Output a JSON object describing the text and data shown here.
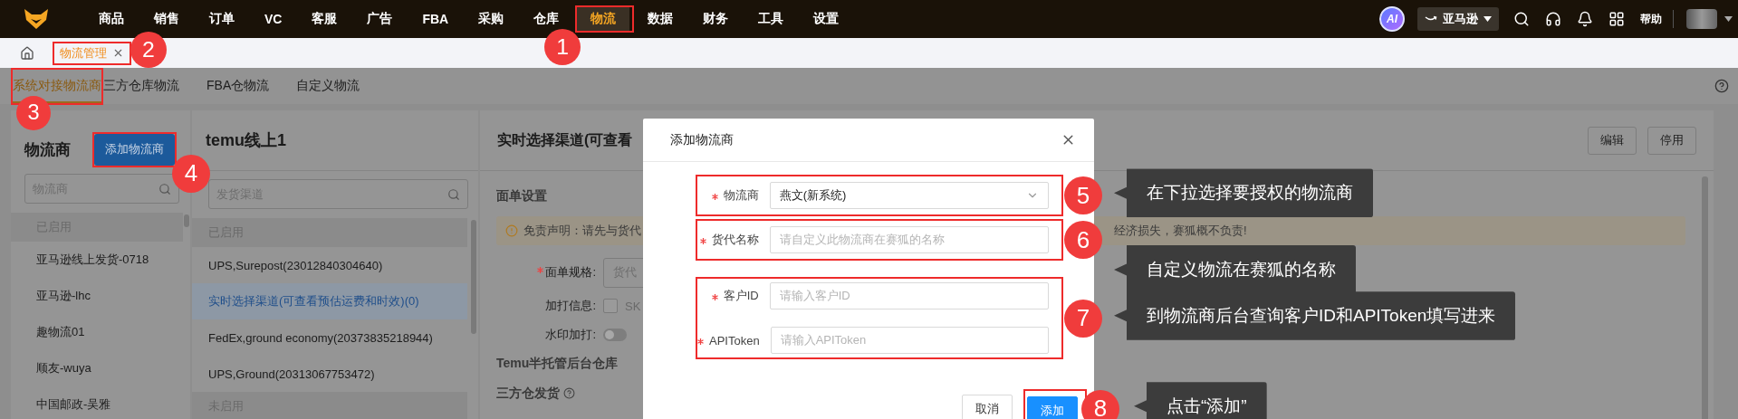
{
  "top_nav": {
    "items": [
      {
        "label": "商品",
        "selected": false
      },
      {
        "label": "销售",
        "selected": false
      },
      {
        "label": "订单",
        "selected": false
      },
      {
        "label": "VC",
        "selected": false
      },
      {
        "label": "客服",
        "selected": false
      },
      {
        "label": "广告",
        "selected": false
      },
      {
        "label": "FBA",
        "selected": false
      },
      {
        "label": "采购",
        "selected": false
      },
      {
        "label": "仓库",
        "selected": false
      },
      {
        "label": "物流",
        "selected": true,
        "step": "1"
      },
      {
        "label": "数据",
        "selected": false
      },
      {
        "label": "财务",
        "selected": false
      },
      {
        "label": "工具",
        "selected": false
      },
      {
        "label": "设置",
        "selected": false
      }
    ],
    "ai_badge": "AI",
    "store_selector": "亚马逊",
    "help": "帮助"
  },
  "page_tabs": [
    {
      "label": "物流管理",
      "selected": true,
      "step": "2"
    }
  ],
  "sub_tabs": [
    {
      "label": "系统对接物流商",
      "selected": true,
      "step": "3"
    },
    {
      "label": "三方仓库物流",
      "selected": false
    },
    {
      "label": "FBA仓物流",
      "selected": false
    },
    {
      "label": "自定义物流",
      "selected": false
    }
  ],
  "carriers_panel": {
    "title": "物流商",
    "add_button": {
      "label": "添加物流商",
      "step": "4"
    },
    "search_placeholder": "物流商",
    "group_label": "已启用",
    "items": [
      "亚马逊线上发货-0718",
      "亚马逊-lhc",
      "趣物流01",
      "顺友-wuya",
      "中国邮政-吴雅"
    ]
  },
  "channels_panel": {
    "title": "temu线上1",
    "search_placeholder": "发货渠道",
    "rows": [
      {
        "kind": "header",
        "label": "已启用"
      },
      {
        "kind": "row",
        "label": "UPS,Surepost(23012840304640)",
        "selected": false
      },
      {
        "kind": "row",
        "label": "实时选择渠道(可查看预估运费和时效)(0)",
        "selected": true
      },
      {
        "kind": "row",
        "label": "FedEx,ground economy(20373835218944)",
        "selected": false
      },
      {
        "kind": "row",
        "label": "UPS,Ground(20313067753472)",
        "selected": false
      },
      {
        "kind": "header",
        "label": "未启用"
      }
    ]
  },
  "detail_panel": {
    "title": "实时选择渠道(可查看",
    "buttons": [
      "编辑",
      "停用"
    ],
    "section_title": "面单设置",
    "notice_left": "免责声明：请先与货代",
    "notice_right": "经济损失，赛狐概不负责!",
    "form": [
      {
        "kind": "select",
        "label": "面单规格:",
        "required": true,
        "placeholder": "货代"
      },
      {
        "kind": "checkbox",
        "label": "加打信息:",
        "checked": false,
        "option": "SK"
      },
      {
        "kind": "switch",
        "label": "水印加打:",
        "on": false
      }
    ],
    "sections": [
      "Temu半托管后台仓库",
      "三方仓发货"
    ]
  },
  "dialog": {
    "title": "添加物流商",
    "field_groups": [
      {
        "step": "5",
        "callout": "在下拉选择要授权的物流商",
        "fields": [
          {
            "kind": "select",
            "label": "物流商",
            "required": true,
            "value": "燕文(新系统)"
          }
        ]
      },
      {
        "step": "6",
        "callout": "自定义物流在赛狐的名称",
        "fields": [
          {
            "kind": "input",
            "label": "货代名称",
            "required": true,
            "placeholder": "请自定义此物流商在赛狐的名称"
          }
        ]
      },
      {
        "step": "7",
        "callout": "到物流商后台查询客户ID和APIToken填写进来",
        "fields": [
          {
            "kind": "input",
            "label": "客户ID",
            "required": true,
            "placeholder": "请输入客户ID"
          },
          {
            "kind": "input",
            "label": "APIToken",
            "required": true,
            "placeholder": "请输入APIToken"
          }
        ]
      }
    ],
    "buttons": [
      {
        "kind": "secondary",
        "label": "取消"
      },
      {
        "kind": "primary",
        "label": "添加",
        "step": "8",
        "callout": "点击“添加”"
      }
    ]
  }
}
